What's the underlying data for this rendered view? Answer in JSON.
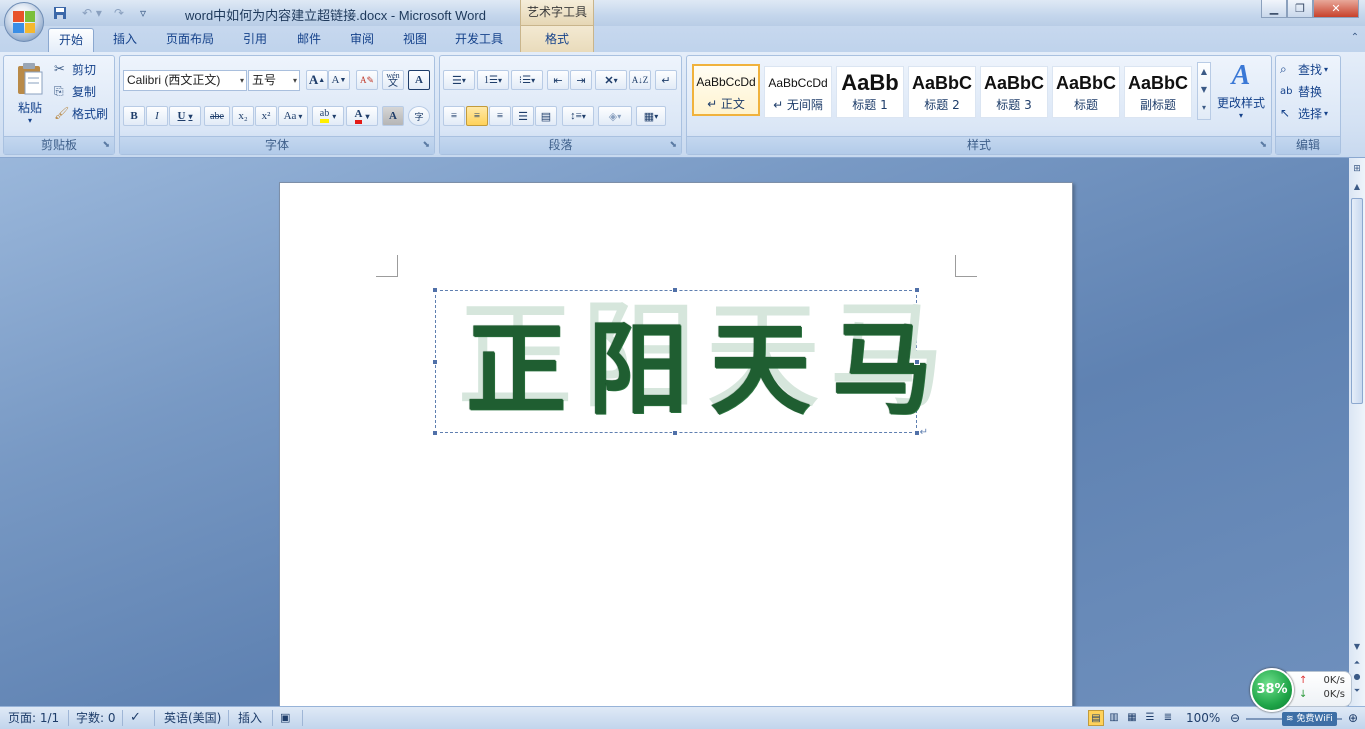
{
  "titlebar": {
    "document_title": "word中如何为内容建立超链接.docx - Microsoft Word",
    "context_group": "艺术字工具",
    "window_buttons": [
      "minimize",
      "restore",
      "close"
    ]
  },
  "tabs": [
    {
      "label": "开始",
      "active": true
    },
    {
      "label": "插入"
    },
    {
      "label": "页面布局"
    },
    {
      "label": "引用"
    },
    {
      "label": "邮件"
    },
    {
      "label": "审阅"
    },
    {
      "label": "视图"
    },
    {
      "label": "开发工具"
    },
    {
      "label": "格式",
      "contextual": true
    }
  ],
  "clipboard": {
    "label": "剪贴板",
    "paste": "粘贴",
    "cut": "剪切",
    "copy": "复制",
    "format_painter": "格式刷"
  },
  "font": {
    "label": "字体",
    "font_name": "Calibri (西文正文)",
    "font_size": "五号",
    "grow": "A",
    "shrink": "A",
    "phonetic": "wén",
    "bold": "B",
    "italic": "I",
    "underline": "U",
    "strike": "abe",
    "subscript": "x₂",
    "superscript": "x²",
    "change_case": "Aa",
    "highlight": "ab",
    "font_color": "A",
    "char_shade": "A",
    "enclose": "字"
  },
  "paragraph": {
    "label": "段落"
  },
  "styles": {
    "label": "样式",
    "items": [
      {
        "preview": "AaBbCcDd",
        "name": "↵ 正文",
        "selected": true
      },
      {
        "preview": "AaBbCcDd",
        "name": "↵ 无间隔"
      },
      {
        "preview": "AaBb",
        "name": "标题 1"
      },
      {
        "preview": "AaBbC",
        "name": "标题 2"
      },
      {
        "preview": "AaBbC",
        "name": "标题 3"
      },
      {
        "preview": "AaBbC",
        "name": "标题"
      },
      {
        "preview": "AaBbC",
        "name": "副标题"
      }
    ],
    "change_styles": "更改样式"
  },
  "editing": {
    "label": "编辑",
    "find": "查找",
    "replace": "替换",
    "select": "选择"
  },
  "document": {
    "wordart_text": "正阳天马",
    "shadow_text": "正阳天马",
    "paragraph_mark": "↵"
  },
  "statusbar": {
    "page": "页面: 1/1",
    "words": "字数: 0",
    "language": "英语(美国)",
    "mode": "插入",
    "zoom": "100%"
  },
  "network_widget": {
    "percent": "38%",
    "upload": "0K/s",
    "download": "0K/s",
    "wifi": "免费WiFi"
  },
  "colors": {
    "wordart_fill": "#1f5e31",
    "wordart_shadow": "#d6e6dc",
    "ribbon_bg": "#dae6f6",
    "accent": "#15428b"
  }
}
